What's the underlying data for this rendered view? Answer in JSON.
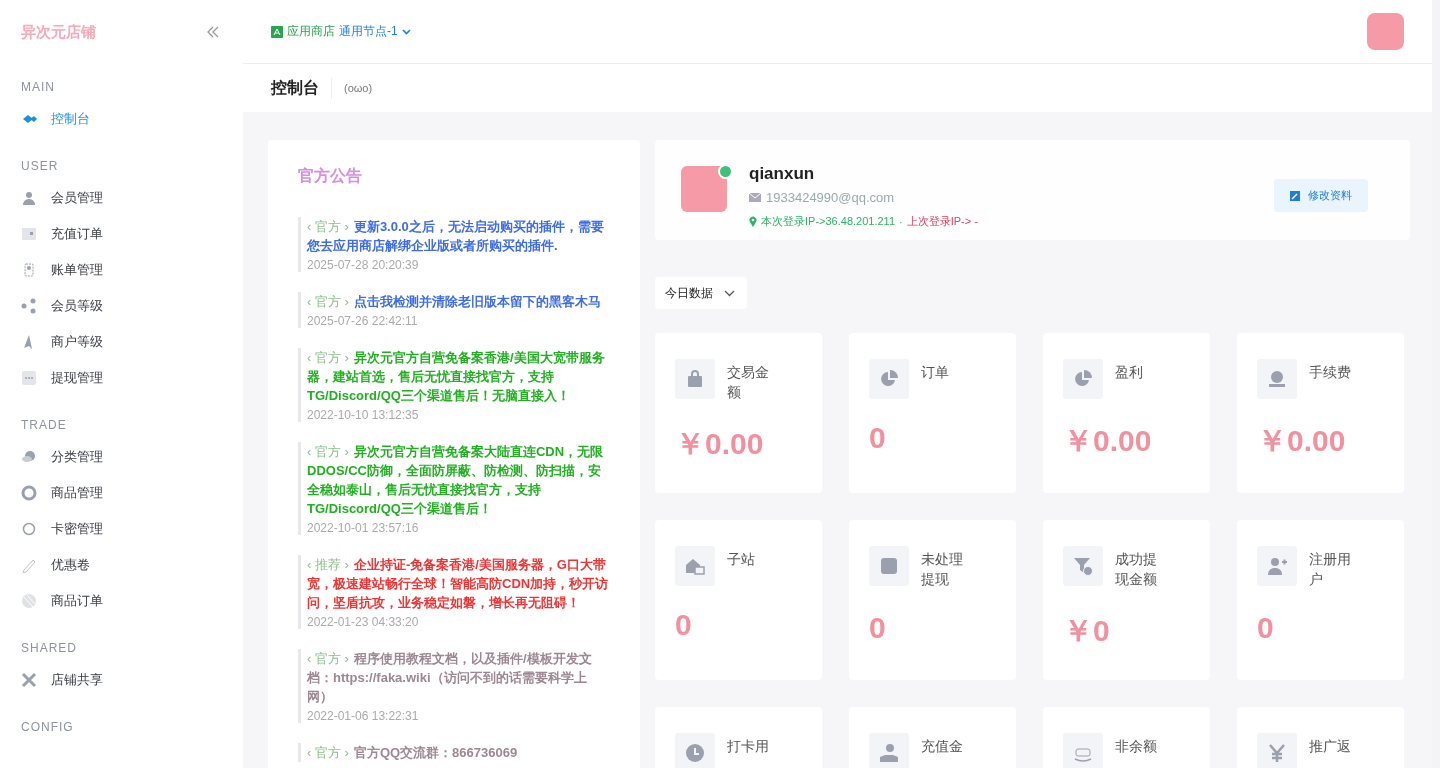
{
  "sidebar": {
    "logo": "异次元店铺",
    "groups": [
      {
        "title": "MAIN",
        "items": [
          {
            "label": "控制台",
            "selected": true
          }
        ]
      },
      {
        "title": "USER",
        "items": [
          {
            "label": "会员管理",
            "selected": false
          },
          {
            "label": "充值订单",
            "selected": false
          },
          {
            "label": "账单管理",
            "selected": false
          },
          {
            "label": "会员等级",
            "selected": false
          },
          {
            "label": "商户等级",
            "selected": false
          },
          {
            "label": "提现管理",
            "selected": false
          }
        ]
      },
      {
        "title": "TRADE",
        "items": [
          {
            "label": "分类管理",
            "selected": false
          },
          {
            "label": "商品管理",
            "selected": false
          },
          {
            "label": "卡密管理",
            "selected": false
          },
          {
            "label": "优惠卷",
            "selected": false
          },
          {
            "label": "商品订单",
            "selected": false
          }
        ]
      },
      {
        "title": "SHARED",
        "items": [
          {
            "label": "店铺共享",
            "selected": false
          }
        ]
      },
      {
        "title": "CONFIG"
      }
    ]
  },
  "header": {
    "app_store": "应用商店",
    "node": "通用节点-1"
  },
  "page_title": {
    "title": "控制台",
    "emoticon": "(oωo)"
  },
  "notices": {
    "title": "官方公告",
    "items": [
      {
        "tag": "‹ 官方 ›",
        "text": "更新3.0.0之后，无法启动购买的插件，需要您去应用商店解绑企业版或者所购买的插件.",
        "time": "2025-07-28 20:20:39",
        "color": "#3d6ce6"
      },
      {
        "tag": "‹ 官方 ›",
        "text": "点击我检测并清除老旧版本留下的黑客木马",
        "time": "2025-07-26 22:42:11",
        "color": "#3d6ce6"
      },
      {
        "tag": "‹ 官方 ›",
        "text": "异次元官方自营免备案香港/美国大宽带服务器，建站首选，售后无忧直接找官方，支持TG/Discord/QQ三个渠道售后！无脑直接入！",
        "time": "2022-10-10 13:12:35",
        "color": "#22b022"
      },
      {
        "tag": "‹ 官方 ›",
        "text": "异次元官方自营免备案大陆直连CDN，无限DDOS/CC防御，全面防屏蔽、防检测、防扫描，安全稳如泰山，售后无忧直接找官方，支持TG/Discord/QQ三个渠道售后！",
        "time": "2022-10-01 23:57:16",
        "color": "#22b022"
      },
      {
        "tag": "‹ 推荐 ›",
        "text": "企业持证-免备案香港/美国服务器，G口大带宽，极速建站畅行全球！智能高防CDN加持，秒开访问，坚盾抗攻，业务稳定如磐，增长再无阻碍！",
        "time": "2022-01-23 04:33:20",
        "color": "#f03434"
      },
      {
        "tag": "‹ 官方 ›",
        "text": "程序使用教程文档，以及插件/模板开发文档：https://faka.wiki（访问不到的话需要科学上网）",
        "time": "2022-01-06 13:22:31",
        "color": "#9c8792"
      },
      {
        "tag": "‹ 官方 ›",
        "text": "官方QQ交流群：866736069",
        "color": "#9c8792"
      }
    ]
  },
  "profile": {
    "username": "qianxun",
    "online": true,
    "email": "1933424990@qq.com",
    "current_ip": "本次登录IP->36.48.201.211",
    "separator": "·",
    "last_ip": "上次登录IP-> -",
    "edit_button": "修改资料"
  },
  "range_select": {
    "value": "今日数据"
  },
  "stats": [
    {
      "label": "交易金额",
      "value": "￥0.00"
    },
    {
      "label": "订单",
      "value": "0"
    },
    {
      "label": "盈利",
      "value": "￥0.00"
    },
    {
      "label": "手续费",
      "value": "￥0.00"
    },
    {
      "label": "子站",
      "value": "0"
    },
    {
      "label": "未处理提现",
      "value": "0"
    },
    {
      "label": "成功提现金额",
      "value": "￥0"
    },
    {
      "label": "注册用户",
      "value": "0"
    },
    {
      "label": "打卡用"
    },
    {
      "label": "充值金"
    },
    {
      "label": "非余额"
    },
    {
      "label": "推广返"
    }
  ]
}
